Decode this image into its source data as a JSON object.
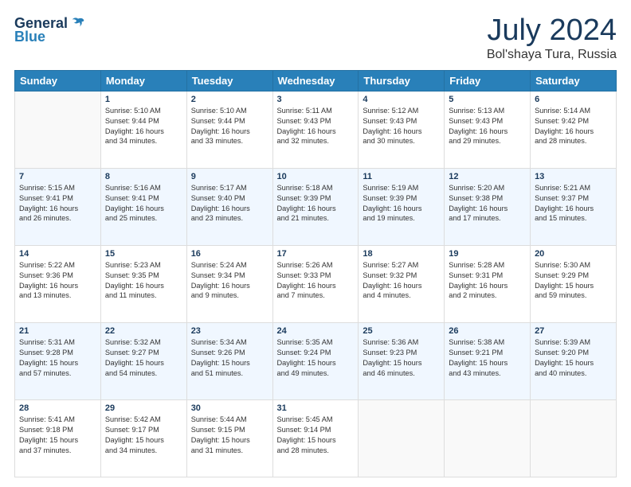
{
  "logo": {
    "general": "General",
    "blue": "Blue"
  },
  "title": "July 2024",
  "location": "Bol'shaya Tura, Russia",
  "days_of_week": [
    "Sunday",
    "Monday",
    "Tuesday",
    "Wednesday",
    "Thursday",
    "Friday",
    "Saturday"
  ],
  "weeks": [
    [
      {
        "num": "",
        "info": ""
      },
      {
        "num": "1",
        "info": "Sunrise: 5:10 AM\nSunset: 9:44 PM\nDaylight: 16 hours\nand 34 minutes."
      },
      {
        "num": "2",
        "info": "Sunrise: 5:10 AM\nSunset: 9:44 PM\nDaylight: 16 hours\nand 33 minutes."
      },
      {
        "num": "3",
        "info": "Sunrise: 5:11 AM\nSunset: 9:43 PM\nDaylight: 16 hours\nand 32 minutes."
      },
      {
        "num": "4",
        "info": "Sunrise: 5:12 AM\nSunset: 9:43 PM\nDaylight: 16 hours\nand 30 minutes."
      },
      {
        "num": "5",
        "info": "Sunrise: 5:13 AM\nSunset: 9:43 PM\nDaylight: 16 hours\nand 29 minutes."
      },
      {
        "num": "6",
        "info": "Sunrise: 5:14 AM\nSunset: 9:42 PM\nDaylight: 16 hours\nand 28 minutes."
      }
    ],
    [
      {
        "num": "7",
        "info": "Sunrise: 5:15 AM\nSunset: 9:41 PM\nDaylight: 16 hours\nand 26 minutes."
      },
      {
        "num": "8",
        "info": "Sunrise: 5:16 AM\nSunset: 9:41 PM\nDaylight: 16 hours\nand 25 minutes."
      },
      {
        "num": "9",
        "info": "Sunrise: 5:17 AM\nSunset: 9:40 PM\nDaylight: 16 hours\nand 23 minutes."
      },
      {
        "num": "10",
        "info": "Sunrise: 5:18 AM\nSunset: 9:39 PM\nDaylight: 16 hours\nand 21 minutes."
      },
      {
        "num": "11",
        "info": "Sunrise: 5:19 AM\nSunset: 9:39 PM\nDaylight: 16 hours\nand 19 minutes."
      },
      {
        "num": "12",
        "info": "Sunrise: 5:20 AM\nSunset: 9:38 PM\nDaylight: 16 hours\nand 17 minutes."
      },
      {
        "num": "13",
        "info": "Sunrise: 5:21 AM\nSunset: 9:37 PM\nDaylight: 16 hours\nand 15 minutes."
      }
    ],
    [
      {
        "num": "14",
        "info": "Sunrise: 5:22 AM\nSunset: 9:36 PM\nDaylight: 16 hours\nand 13 minutes."
      },
      {
        "num": "15",
        "info": "Sunrise: 5:23 AM\nSunset: 9:35 PM\nDaylight: 16 hours\nand 11 minutes."
      },
      {
        "num": "16",
        "info": "Sunrise: 5:24 AM\nSunset: 9:34 PM\nDaylight: 16 hours\nand 9 minutes."
      },
      {
        "num": "17",
        "info": "Sunrise: 5:26 AM\nSunset: 9:33 PM\nDaylight: 16 hours\nand 7 minutes."
      },
      {
        "num": "18",
        "info": "Sunrise: 5:27 AM\nSunset: 9:32 PM\nDaylight: 16 hours\nand 4 minutes."
      },
      {
        "num": "19",
        "info": "Sunrise: 5:28 AM\nSunset: 9:31 PM\nDaylight: 16 hours\nand 2 minutes."
      },
      {
        "num": "20",
        "info": "Sunrise: 5:30 AM\nSunset: 9:29 PM\nDaylight: 15 hours\nand 59 minutes."
      }
    ],
    [
      {
        "num": "21",
        "info": "Sunrise: 5:31 AM\nSunset: 9:28 PM\nDaylight: 15 hours\nand 57 minutes."
      },
      {
        "num": "22",
        "info": "Sunrise: 5:32 AM\nSunset: 9:27 PM\nDaylight: 15 hours\nand 54 minutes."
      },
      {
        "num": "23",
        "info": "Sunrise: 5:34 AM\nSunset: 9:26 PM\nDaylight: 15 hours\nand 51 minutes."
      },
      {
        "num": "24",
        "info": "Sunrise: 5:35 AM\nSunset: 9:24 PM\nDaylight: 15 hours\nand 49 minutes."
      },
      {
        "num": "25",
        "info": "Sunrise: 5:36 AM\nSunset: 9:23 PM\nDaylight: 15 hours\nand 46 minutes."
      },
      {
        "num": "26",
        "info": "Sunrise: 5:38 AM\nSunset: 9:21 PM\nDaylight: 15 hours\nand 43 minutes."
      },
      {
        "num": "27",
        "info": "Sunrise: 5:39 AM\nSunset: 9:20 PM\nDaylight: 15 hours\nand 40 minutes."
      }
    ],
    [
      {
        "num": "28",
        "info": "Sunrise: 5:41 AM\nSunset: 9:18 PM\nDaylight: 15 hours\nand 37 minutes."
      },
      {
        "num": "29",
        "info": "Sunrise: 5:42 AM\nSunset: 9:17 PM\nDaylight: 15 hours\nand 34 minutes."
      },
      {
        "num": "30",
        "info": "Sunrise: 5:44 AM\nSunset: 9:15 PM\nDaylight: 15 hours\nand 31 minutes."
      },
      {
        "num": "31",
        "info": "Sunrise: 5:45 AM\nSunset: 9:14 PM\nDaylight: 15 hours\nand 28 minutes."
      },
      {
        "num": "",
        "info": ""
      },
      {
        "num": "",
        "info": ""
      },
      {
        "num": "",
        "info": ""
      }
    ]
  ]
}
